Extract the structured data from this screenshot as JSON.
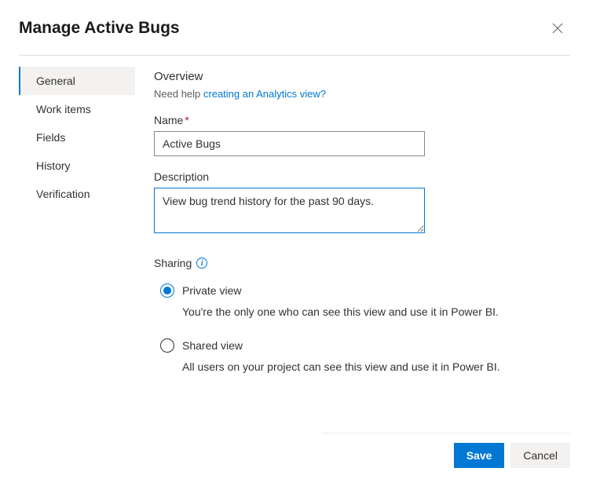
{
  "header": {
    "title": "Manage Active Bugs"
  },
  "sidebar": {
    "items": [
      {
        "label": "General",
        "selected": true
      },
      {
        "label": "Work items",
        "selected": false
      },
      {
        "label": "Fields",
        "selected": false
      },
      {
        "label": "History",
        "selected": false
      },
      {
        "label": "Verification",
        "selected": false
      }
    ]
  },
  "main": {
    "overview_heading": "Overview",
    "help_prefix": "Need help ",
    "help_link_text": "creating an Analytics view?",
    "name_label": "Name",
    "name_value": "Active Bugs",
    "description_label": "Description",
    "description_value": "View bug trend history for the past 90 days.",
    "sharing_label": "Sharing",
    "sharing_options": [
      {
        "label": "Private view",
        "description": "You're the only one who can see this view and use it in Power BI.",
        "checked": true
      },
      {
        "label": "Shared view",
        "description": "All users on your project can see this view and use it in Power BI.",
        "checked": false
      }
    ]
  },
  "footer": {
    "save": "Save",
    "cancel": "Cancel"
  }
}
